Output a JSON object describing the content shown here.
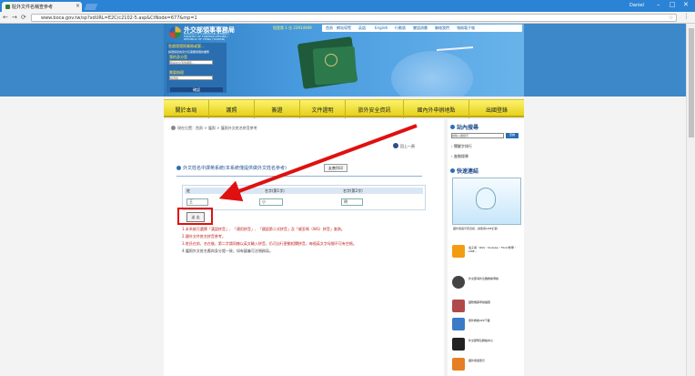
{
  "browser": {
    "tab_title": "駐外文件名稱查參考",
    "tab_close": "×",
    "user": "Daniel",
    "minimize": "–",
    "restore": "□",
    "close": "✕",
    "back": "←",
    "forward": "→",
    "reload": "⟳",
    "url": "www.boca.gov.tw/sp?xdURL=E2C/c2102-5.asp&CtNode=677&mp=1",
    "star": "☆",
    "menu": "⋮"
  },
  "header": {
    "site_name": "外交部領事事務局",
    "site_sub": "BUREAU OF CONSULAR AFFAIRS / MINISTRY OF FOREIGN AFFAIRS / REPUBLIC OF CHINA (TAIWAN)",
    "counter": "您是第 1 位 23914949",
    "top_links": [
      "首頁",
      "網站導覽",
      "英語",
      "English",
      "行動版",
      "雙語詞彙",
      "聯絡我們",
      "領務電子報"
    ],
    "left_q": "急處理證照業務或要...",
    "left_q2": "請選擇您的身分及需要辦理的業務",
    "label_identity": "我的身分是",
    "select_identity": "我是在台灣的國民...",
    "label_service": "需要辦理",
    "select_service": "請選擇",
    "ok": "確認"
  },
  "menu": [
    "關於本局",
    "護照",
    "簽證",
    "文件證明",
    "旅外安全資訊",
    "國內外申辦地點",
    "出國登錄"
  ],
  "content": {
    "breadcrumb": "現在位置：首頁 > 護照 > 護照外文姓名拼音參考",
    "back_label": "回上一頁",
    "title": "外文姓名中譯英系統(本系統僅提供做外文姓名參考)",
    "print_btn": "友善列印",
    "col_surname": "姓",
    "col_given1": "名字(第1字)",
    "col_given2": "名字(第2字)",
    "val_surname": "王",
    "val_given1": "小",
    "val_given2": "明",
    "send_btn": "送 出",
    "notes": [
      "1.本系統可選擇「漢語拼音」、「通用拼音」、「國語第二式拼音」及「威妥瑪（WG）拼音」查詢。",
      "2.國外文件姓名拼音參考。",
      "3.姓氏在前、名在後，第二字請同樣以英文輸入拼音，仍可自行更動相關拼音，每個英文字母間不可有空格。",
      "4.護照外文姓名應與身分證一致，如有疑義可洽領務局。"
    ]
  },
  "sidebar": {
    "search_title": "站內搜尋",
    "search_placeholder": "請輸入關鍵字",
    "search_btn": "查詢",
    "link1": "› 關鍵字排行",
    "link2": "› 進階搜尋",
    "quick_title": "快速連結",
    "banner_caption": "國外旅遊平安資訊，請使用LINE訂閱",
    "items": [
      "電子報・RSS・Youtube・Flickr粉專・LINE...",
      "外交部海外急難救助專線",
      "國際機票申辦護照",
      "旅外救助APP下載",
      "外交部緊急聯絡中心",
      "國外旅遊警示"
    ]
  }
}
